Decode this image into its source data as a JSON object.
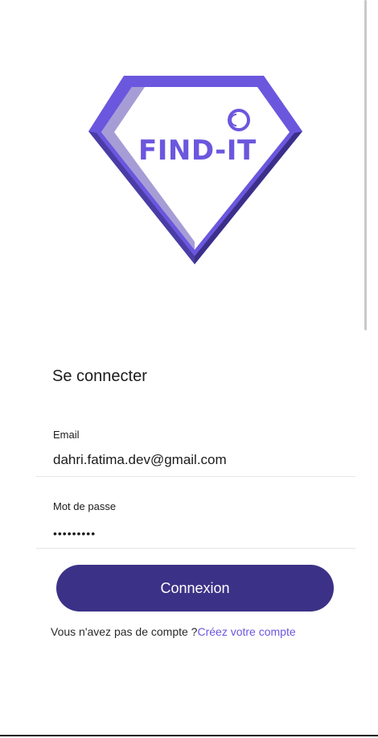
{
  "logo": {
    "text": "FIND-IT",
    "colors": {
      "outer": "#6b57de",
      "outer_dark": "#3b2f8a",
      "inner_shade": "#a69dd6",
      "text": "#6b57de"
    }
  },
  "login": {
    "title": "Se connecter",
    "email": {
      "label": "Email",
      "value": "dahri.fatima.dev@gmail.com"
    },
    "password": {
      "label": "Mot de passe",
      "value": "•••••••••"
    },
    "submit_label": "Connexion",
    "signup_prompt": "Vous n'avez pas de compte ?",
    "signup_link": "Créez votre compte"
  },
  "colors": {
    "primary": "#3b3287",
    "link": "#6b57de"
  }
}
